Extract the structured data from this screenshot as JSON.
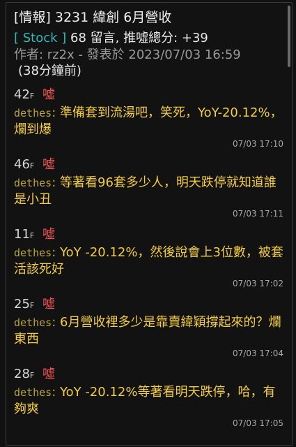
{
  "header": {
    "title": "[情報] 3231 緯創 6月營收",
    "board": "[ Stock ]",
    "stats": "68 留言, 推噓總分: +39",
    "author_line": "作者: rz2x - 發表於 2023/07/03 16:59",
    "elapsed": "(38分鐘前)"
  },
  "comments": [
    {
      "floor": "42",
      "floor_suffix": "F",
      "tag": "噓",
      "user": "dethes",
      "text": "準備套到流湯吧，笑死，YoY-20.12%，爛到爆",
      "time": "07/03 17:10"
    },
    {
      "floor": "46",
      "floor_suffix": "F",
      "tag": "噓",
      "user": "dethes",
      "text": "等著看96套多少人，明天跌停就知道誰是小丑",
      "time": "07/03 17:11"
    },
    {
      "floor": "11",
      "floor_suffix": "F",
      "tag": "噓",
      "user": "dethes",
      "text": "YoY -20.12%，然後說會上3位數，被套活該死好",
      "time": "07/03 17:02"
    },
    {
      "floor": "25",
      "floor_suffix": "F",
      "tag": "噓",
      "user": "dethes",
      "text": "6月營收裡多少是靠賣緯穎撐起來的？爛東西",
      "time": "07/03 17:04"
    },
    {
      "floor": "28",
      "floor_suffix": "F",
      "tag": "噓",
      "user": "dethes",
      "text": "YoY -20.12%等著看明天跌停，哈，有夠爽",
      "time": "07/03 17:05"
    }
  ],
  "colors": {
    "board": "#35b7b9",
    "tag": "#ef5050",
    "comment_text": "#f3cd3f",
    "author_meta": "#9a9a9a"
  }
}
